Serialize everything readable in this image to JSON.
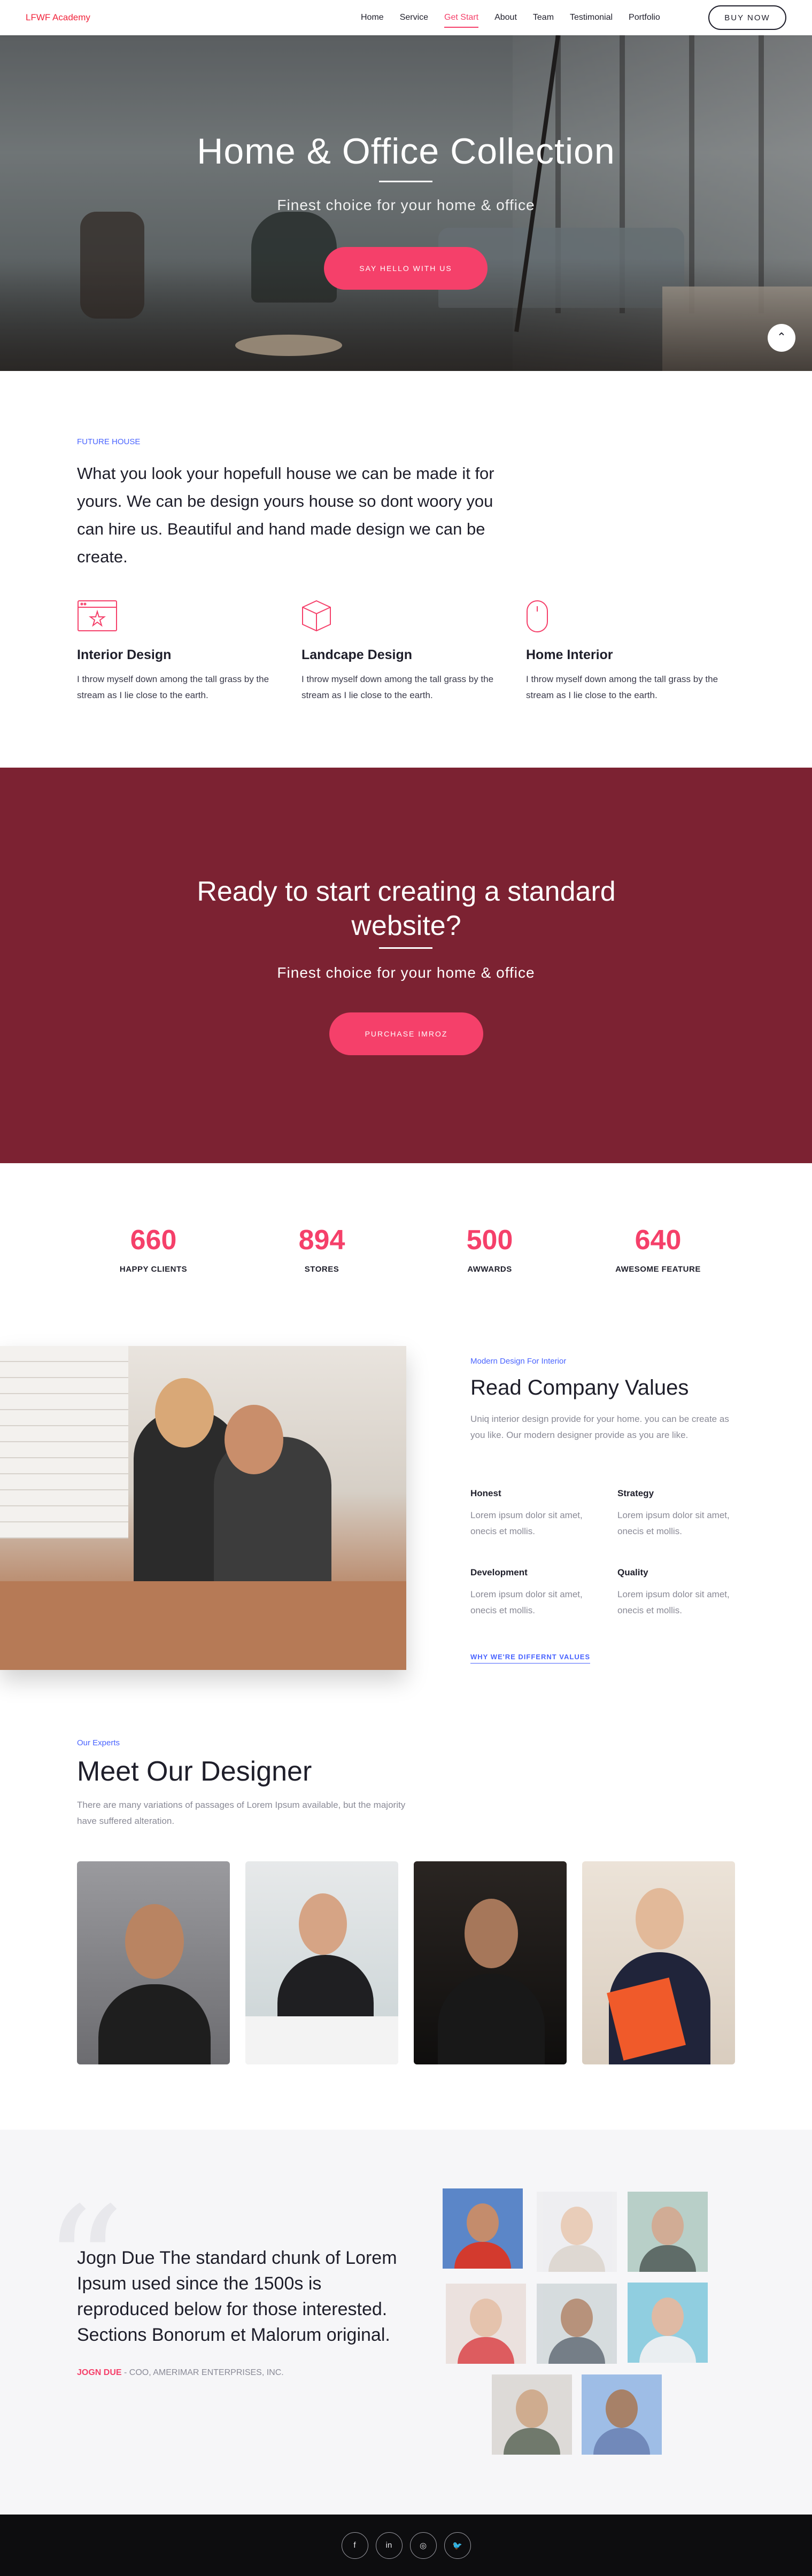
{
  "nav": {
    "brand": "LFWF Academy",
    "items": [
      "Home",
      "Service",
      "Get Start",
      "About",
      "Team",
      "Testimonial",
      "Portfolio"
    ],
    "active": "Get Start",
    "buy_label": "BUY NOW"
  },
  "hero": {
    "title": "Home & Office Collection",
    "subtitle": "Finest choice for your home & office",
    "cta": "SAY HELLO WITH US",
    "scroll_icon": "chevron-up-icon"
  },
  "features": {
    "eyebrow": "FUTURE HOUSE",
    "intro": "What you look your hopefull house we can be made it for yours. We can be design yours house so dont woory you can hire us. Beautiful and hand made design we can be create.",
    "items": [
      {
        "icon": "browser-star-icon",
        "title": "Interior Design",
        "text": "I throw myself down among the tall grass by the stream as I lie close to the earth."
      },
      {
        "icon": "cube-icon",
        "title": "Landcape Design",
        "text": "I throw myself down among the tall grass by the stream as I lie close to the earth."
      },
      {
        "icon": "mouse-icon",
        "title": "Home Interior",
        "text": "I throw myself down among the tall grass by the stream as I lie close to the earth."
      }
    ]
  },
  "ready": {
    "title": "Ready to start creating a standard website?",
    "subtitle": "Finest choice for your home & office",
    "cta": "PURCHASE IMROZ",
    "background": "#7c2232"
  },
  "stats": [
    {
      "value": "660",
      "label": "HAPPY CLIENTS"
    },
    {
      "value": "894",
      "label": "STORES"
    },
    {
      "value": "500",
      "label": "AWWARDS"
    },
    {
      "value": "640",
      "label": "AWESOME FEATURE"
    }
  ],
  "values": {
    "eyebrow": "Modern Design For Interior",
    "title": "Read Company Values",
    "description": "Uniq interior design provide for your home. you can be create as you like. Our modern designer provide as you are like.",
    "items": [
      {
        "title": "Honest",
        "text": "Lorem ipsum dolor sit amet, onecis et mollis."
      },
      {
        "title": "Strategy",
        "text": "Lorem ipsum dolor sit amet, onecis et mollis."
      },
      {
        "title": "Development",
        "text": "Lorem ipsum dolor sit amet, onecis et mollis."
      },
      {
        "title": "Quality",
        "text": "Lorem ipsum dolor sit amet, onecis et mollis."
      }
    ],
    "link": "WHY WE'RE DIFFERNT VALUES"
  },
  "team": {
    "eyebrow": "Our Experts",
    "title": "Meet Our Designer",
    "description": "There are many variations of passages of Lorem Ipsum available, but the majority have suffered alteration."
  },
  "testimonial": {
    "quote": "Jogn Due The standard chunk of Lorem Ipsum used since the 1500s is reproduced below for those interested. Sections Bonorum et Malorum original.",
    "author": "JOGN DUE",
    "role": " - COO, AMERIMAR ENTERPRISES, INC."
  },
  "footer": {
    "social": [
      {
        "icon": "facebook-icon",
        "glyph": "f"
      },
      {
        "icon": "linkedin-icon",
        "glyph": "in"
      },
      {
        "icon": "instagram-icon",
        "glyph": "◎"
      },
      {
        "icon": "twitter-icon",
        "glyph": "🐦"
      }
    ]
  },
  "colors": {
    "accent": "#f5406a",
    "link": "#4a64ff",
    "brand": "#f1243c"
  }
}
